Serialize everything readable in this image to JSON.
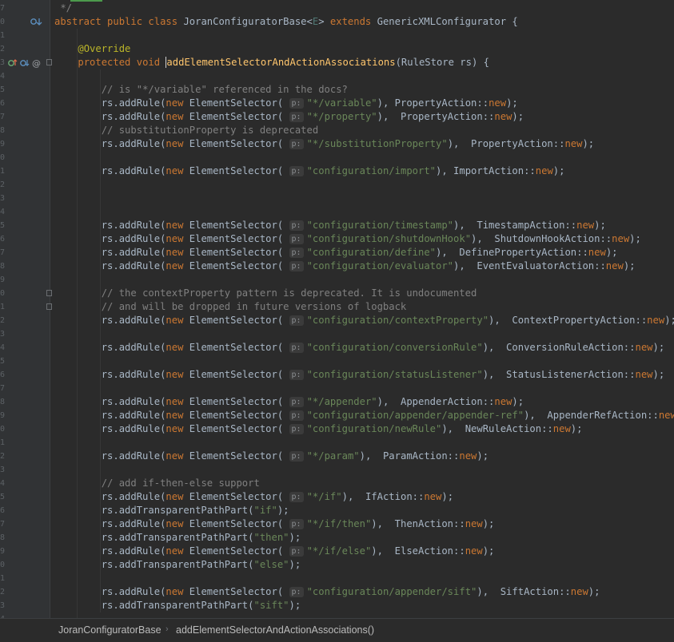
{
  "editor": {
    "lines": [
      {
        "n": "7",
        "parts": [
          [
            "cmt",
            " */"
          ]
        ]
      },
      {
        "n": "0",
        "gutter": "override-down",
        "parts": [
          [
            "kw",
            "abstract public class "
          ],
          [
            "txt",
            "JoranConfiguratorBase<"
          ],
          [
            "tp",
            "E"
          ],
          [
            "txt",
            "> "
          ],
          [
            "kw",
            "extends "
          ],
          [
            "txt",
            "GenericXMLConfigurator {"
          ]
        ]
      },
      {
        "n": "1",
        "parts": []
      },
      {
        "n": "2",
        "parts": [
          [
            "txt",
            "    "
          ],
          [
            "ann",
            "@Override"
          ]
        ]
      },
      {
        "n": "3",
        "gutter": "implement-override-annot",
        "fold": true,
        "parts": [
          [
            "txt",
            "    "
          ],
          [
            "kw",
            "protected void "
          ],
          [
            "cursor",
            "a"
          ],
          [
            "fn",
            "ddElementSelectorAndActionAssociations"
          ],
          [
            "txt",
            "(RuleStore rs) {"
          ]
        ]
      },
      {
        "n": "4",
        "parts": []
      },
      {
        "n": "5",
        "parts": [
          [
            "txt",
            "        "
          ],
          [
            "cmt",
            "// is \"*/variable\" referenced in the docs?"
          ]
        ]
      },
      {
        "n": "6",
        "parts": [
          [
            "txt",
            "        rs.addRule("
          ],
          [
            "kw",
            "new "
          ],
          [
            "txt",
            "ElementSelector( "
          ],
          [
            "hint",
            "p:"
          ],
          [
            "str",
            "\"*/variable\""
          ],
          [
            "txt",
            "), PropertyAction::"
          ],
          [
            "kw",
            "new"
          ],
          [
            "txt",
            ");"
          ]
        ]
      },
      {
        "n": "7",
        "parts": [
          [
            "txt",
            "        rs.addRule("
          ],
          [
            "kw",
            "new "
          ],
          [
            "txt",
            "ElementSelector( "
          ],
          [
            "hint",
            "p:"
          ],
          [
            "str",
            "\"*/property\""
          ],
          [
            "txt",
            "),  PropertyAction::"
          ],
          [
            "kw",
            "new"
          ],
          [
            "txt",
            ");"
          ]
        ]
      },
      {
        "n": "8",
        "parts": [
          [
            "txt",
            "        "
          ],
          [
            "cmt",
            "// substitutionProperty is deprecated"
          ]
        ]
      },
      {
        "n": "9",
        "parts": [
          [
            "txt",
            "        rs.addRule("
          ],
          [
            "kw",
            "new "
          ],
          [
            "txt",
            "ElementSelector( "
          ],
          [
            "hint",
            "p:"
          ],
          [
            "str",
            "\"*/substitutionProperty\""
          ],
          [
            "txt",
            "),  PropertyAction::"
          ],
          [
            "kw",
            "new"
          ],
          [
            "txt",
            ");"
          ]
        ]
      },
      {
        "n": "0",
        "parts": []
      },
      {
        "n": "1",
        "parts": [
          [
            "txt",
            "        rs.addRule("
          ],
          [
            "kw",
            "new "
          ],
          [
            "txt",
            "ElementSelector( "
          ],
          [
            "hint",
            "p:"
          ],
          [
            "str",
            "\"configuration/import\""
          ],
          [
            "txt",
            "), ImportAction::"
          ],
          [
            "kw",
            "new"
          ],
          [
            "txt",
            ");"
          ]
        ]
      },
      {
        "n": "2",
        "parts": []
      },
      {
        "n": "3",
        "parts": []
      },
      {
        "n": "4",
        "parts": []
      },
      {
        "n": "5",
        "parts": [
          [
            "txt",
            "        rs.addRule("
          ],
          [
            "kw",
            "new "
          ],
          [
            "txt",
            "ElementSelector( "
          ],
          [
            "hint",
            "p:"
          ],
          [
            "str",
            "\"configuration/timestamp\""
          ],
          [
            "txt",
            "),  TimestampAction::"
          ],
          [
            "kw",
            "new"
          ],
          [
            "txt",
            ");"
          ]
        ]
      },
      {
        "n": "6",
        "parts": [
          [
            "txt",
            "        rs.addRule("
          ],
          [
            "kw",
            "new "
          ],
          [
            "txt",
            "ElementSelector( "
          ],
          [
            "hint",
            "p:"
          ],
          [
            "str",
            "\"configuration/shutdownHook\""
          ],
          [
            "txt",
            "),  ShutdownHookAction::"
          ],
          [
            "kw",
            "new"
          ],
          [
            "txt",
            ");"
          ]
        ]
      },
      {
        "n": "7",
        "parts": [
          [
            "txt",
            "        rs.addRule("
          ],
          [
            "kw",
            "new "
          ],
          [
            "txt",
            "ElementSelector( "
          ],
          [
            "hint",
            "p:"
          ],
          [
            "str",
            "\"configuration/define\""
          ],
          [
            "txt",
            "),  DefinePropertyAction::"
          ],
          [
            "kw",
            "new"
          ],
          [
            "txt",
            ");"
          ]
        ]
      },
      {
        "n": "8",
        "parts": [
          [
            "txt",
            "        rs.addRule("
          ],
          [
            "kw",
            "new "
          ],
          [
            "txt",
            "ElementSelector( "
          ],
          [
            "hint",
            "p:"
          ],
          [
            "str",
            "\"configuration/evaluator\""
          ],
          [
            "txt",
            "),  EventEvaluatorAction::"
          ],
          [
            "kw",
            "new"
          ],
          [
            "txt",
            ");"
          ]
        ]
      },
      {
        "n": "9",
        "parts": []
      },
      {
        "n": "0",
        "fold": true,
        "parts": [
          [
            "txt",
            "        "
          ],
          [
            "cmt",
            "// the contextProperty pattern is deprecated. It is undocumented"
          ]
        ]
      },
      {
        "n": "1",
        "fold": true,
        "parts": [
          [
            "txt",
            "        "
          ],
          [
            "cmt",
            "// and will be dropped in future versions of logback"
          ]
        ]
      },
      {
        "n": "2",
        "parts": [
          [
            "txt",
            "        rs.addRule("
          ],
          [
            "kw",
            "new "
          ],
          [
            "txt",
            "ElementSelector( "
          ],
          [
            "hint",
            "p:"
          ],
          [
            "str",
            "\"configuration/contextProperty\""
          ],
          [
            "txt",
            "),  ContextPropertyAction::"
          ],
          [
            "kw",
            "new"
          ],
          [
            "txt",
            ");"
          ]
        ]
      },
      {
        "n": "3",
        "parts": []
      },
      {
        "n": "4",
        "parts": [
          [
            "txt",
            "        rs.addRule("
          ],
          [
            "kw",
            "new "
          ],
          [
            "txt",
            "ElementSelector( "
          ],
          [
            "hint",
            "p:"
          ],
          [
            "str",
            "\"configuration/conversionRule\""
          ],
          [
            "txt",
            "),  ConversionRuleAction::"
          ],
          [
            "kw",
            "new"
          ],
          [
            "txt",
            ");"
          ]
        ]
      },
      {
        "n": "5",
        "parts": []
      },
      {
        "n": "6",
        "parts": [
          [
            "txt",
            "        rs.addRule("
          ],
          [
            "kw",
            "new "
          ],
          [
            "txt",
            "ElementSelector( "
          ],
          [
            "hint",
            "p:"
          ],
          [
            "str",
            "\"configuration/statusListener\""
          ],
          [
            "txt",
            "),  StatusListenerAction::"
          ],
          [
            "kw",
            "new"
          ],
          [
            "txt",
            ");"
          ]
        ]
      },
      {
        "n": "7",
        "parts": []
      },
      {
        "n": "8",
        "parts": [
          [
            "txt",
            "        rs.addRule("
          ],
          [
            "kw",
            "new "
          ],
          [
            "txt",
            "ElementSelector( "
          ],
          [
            "hint",
            "p:"
          ],
          [
            "str",
            "\"*/appender\""
          ],
          [
            "txt",
            "),  AppenderAction::"
          ],
          [
            "kw",
            "new"
          ],
          [
            "txt",
            ");"
          ]
        ]
      },
      {
        "n": "9",
        "parts": [
          [
            "txt",
            "        rs.addRule("
          ],
          [
            "kw",
            "new "
          ],
          [
            "txt",
            "ElementSelector( "
          ],
          [
            "hint",
            "p:"
          ],
          [
            "str",
            "\"configuration/appender/appender-ref\""
          ],
          [
            "txt",
            "),  AppenderRefAction::"
          ],
          [
            "kw",
            "new"
          ],
          [
            "txt",
            ");"
          ]
        ]
      },
      {
        "n": "0",
        "parts": [
          [
            "txt",
            "        rs.addRule("
          ],
          [
            "kw",
            "new "
          ],
          [
            "txt",
            "ElementSelector( "
          ],
          [
            "hint",
            "p:"
          ],
          [
            "str",
            "\"configuration/newRule\""
          ],
          [
            "txt",
            "),  NewRuleAction::"
          ],
          [
            "kw",
            "new"
          ],
          [
            "txt",
            ");"
          ]
        ]
      },
      {
        "n": "1",
        "parts": []
      },
      {
        "n": "2",
        "parts": [
          [
            "txt",
            "        rs.addRule("
          ],
          [
            "kw",
            "new "
          ],
          [
            "txt",
            "ElementSelector( "
          ],
          [
            "hint",
            "p:"
          ],
          [
            "str",
            "\"*/param\""
          ],
          [
            "txt",
            "),  ParamAction::"
          ],
          [
            "kw",
            "new"
          ],
          [
            "txt",
            ");"
          ]
        ]
      },
      {
        "n": "3",
        "parts": []
      },
      {
        "n": "4",
        "parts": [
          [
            "txt",
            "        "
          ],
          [
            "cmt",
            "// add if-then-else support"
          ]
        ]
      },
      {
        "n": "5",
        "parts": [
          [
            "txt",
            "        rs.addRule("
          ],
          [
            "kw",
            "new "
          ],
          [
            "txt",
            "ElementSelector( "
          ],
          [
            "hint",
            "p:"
          ],
          [
            "str",
            "\"*/if\""
          ],
          [
            "txt",
            "),  IfAction::"
          ],
          [
            "kw",
            "new"
          ],
          [
            "txt",
            ");"
          ]
        ]
      },
      {
        "n": "6",
        "parts": [
          [
            "txt",
            "        rs.addTransparentPathPart("
          ],
          [
            "str",
            "\"if\""
          ],
          [
            "txt",
            ");"
          ]
        ]
      },
      {
        "n": "7",
        "parts": [
          [
            "txt",
            "        rs.addRule("
          ],
          [
            "kw",
            "new "
          ],
          [
            "txt",
            "ElementSelector( "
          ],
          [
            "hint",
            "p:"
          ],
          [
            "str",
            "\"*/if/then\""
          ],
          [
            "txt",
            "),  ThenAction::"
          ],
          [
            "kw",
            "new"
          ],
          [
            "txt",
            ");"
          ]
        ]
      },
      {
        "n": "8",
        "parts": [
          [
            "txt",
            "        rs.addTransparentPathPart("
          ],
          [
            "str",
            "\"then\""
          ],
          [
            "txt",
            ");"
          ]
        ]
      },
      {
        "n": "9",
        "parts": [
          [
            "txt",
            "        rs.addRule("
          ],
          [
            "kw",
            "new "
          ],
          [
            "txt",
            "ElementSelector( "
          ],
          [
            "hint",
            "p:"
          ],
          [
            "str",
            "\"*/if/else\""
          ],
          [
            "txt",
            "),  ElseAction::"
          ],
          [
            "kw",
            "new"
          ],
          [
            "txt",
            ");"
          ]
        ]
      },
      {
        "n": "0",
        "parts": [
          [
            "txt",
            "        rs.addTransparentPathPart("
          ],
          [
            "str",
            "\"else\""
          ],
          [
            "txt",
            ");"
          ]
        ]
      },
      {
        "n": "1",
        "parts": []
      },
      {
        "n": "2",
        "parts": [
          [
            "txt",
            "        rs.addRule("
          ],
          [
            "kw",
            "new "
          ],
          [
            "txt",
            "ElementSelector( "
          ],
          [
            "hint",
            "p:"
          ],
          [
            "str",
            "\"configuration/appender/sift\""
          ],
          [
            "txt",
            "),  SiftAction::"
          ],
          [
            "kw",
            "new"
          ],
          [
            "txt",
            ");"
          ]
        ]
      },
      {
        "n": "3",
        "parts": [
          [
            "txt",
            "        rs.addTransparentPathPart("
          ],
          [
            "str",
            "\"sift\""
          ],
          [
            "txt",
            ");"
          ]
        ]
      },
      {
        "n": "4",
        "parts": []
      },
      {
        "n": "5",
        "parts": []
      }
    ]
  },
  "breadcrumb": {
    "items": [
      "JoranConfiguratorBase",
      "addElementSelectorAndActionAssociations()"
    ],
    "separator": "›"
  }
}
